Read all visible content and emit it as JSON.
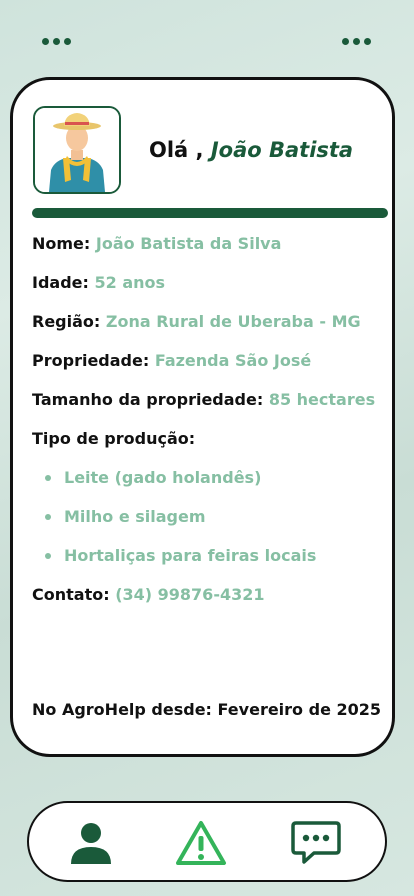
{
  "greeting": {
    "prefix": "Olá ,",
    "name": "João Batista"
  },
  "profile": {
    "rows": [
      {
        "label": "Nome:",
        "value": "João Batista da Silva"
      },
      {
        "label": "Idade:",
        "value": "52 anos"
      },
      {
        "label": "Região:",
        "value": "Zona Rural de Uberaba - MG"
      },
      {
        "label": "Propriedade:",
        "value": "Fazenda São José"
      },
      {
        "label": "Tamanho da propriedade:",
        "value": "85 hectares"
      }
    ],
    "production_label": "Tipo de produção:",
    "production_items": [
      "Leite (gado holandês)",
      "Milho e silagem",
      "Hortaliças para feiras locais"
    ],
    "contact_label": "Contato:",
    "contact_value": "(34) 99876-4321",
    "member_since": "No AgroHelp desde: Fevereiro de 2025"
  },
  "nav": {
    "items": [
      {
        "icon": "person-icon"
      },
      {
        "icon": "alert-triangle-icon"
      },
      {
        "icon": "chat-bubble-icon"
      }
    ]
  },
  "colors": {
    "primary": "#1a5a3a",
    "accent": "#86bfa3",
    "alert": "#34b45a"
  }
}
